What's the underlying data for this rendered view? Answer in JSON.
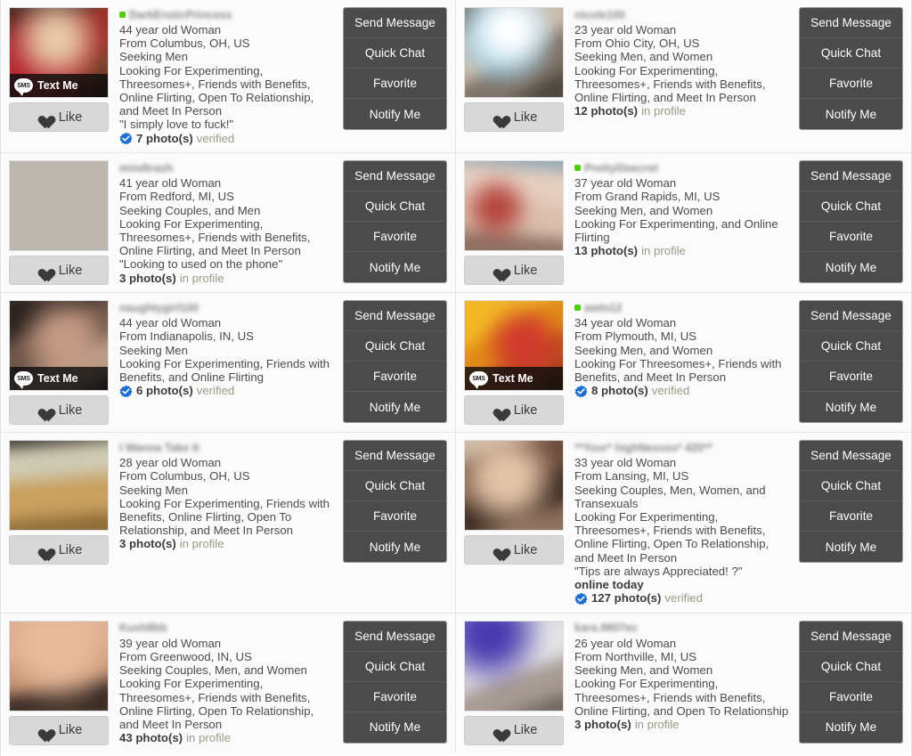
{
  "ui": {
    "like_label": "Like",
    "text_me_label": "Text Me",
    "sms_badge_label": "SMS",
    "actions": [
      "Send Message",
      "Quick Chat",
      "Favorite",
      "Notify Me"
    ]
  },
  "cards": [
    {
      "username": "DarkEroticPrincess",
      "online_dot": true,
      "text_me": true,
      "photo_class": "ph-1",
      "lines": [
        "44 year old Woman",
        "From Columbus, OH, US",
        "Seeking Men",
        "Looking For Experimenting, Threesomes+, Friends with Benefits, Online Flirting, Open To Relationship, and Meet In Person"
      ],
      "quote": "\"I simply love to fuck!\"",
      "online_today": null,
      "photo_count": "7 photo(s)",
      "photo_status": "verified",
      "verified": true
    },
    {
      "username": "nicole100",
      "online_dot": false,
      "text_me": false,
      "photo_class": "ph-2",
      "lines": [
        "23 year old Woman",
        "From Ohio City, OH, US",
        "Seeking Men, and Women",
        "Looking For Experimenting, Threesomes+, Friends with Benefits, Online Flirting, and Meet In Person"
      ],
      "quote": null,
      "online_today": null,
      "photo_count": "12 photo(s)",
      "photo_status": "in profile",
      "verified": false
    },
    {
      "username": "mindtrash",
      "online_dot": false,
      "text_me": false,
      "photo_class": "ph-3",
      "lines": [
        "41 year old Woman",
        "From Redford, MI, US",
        "Seeking Couples, and Men",
        "Looking For Experimenting, Threesomes+, Friends with Benefits, Online Flirting, and Meet In Person"
      ],
      "quote": "\"Looking to used on the phone\"",
      "online_today": null,
      "photo_count": "3 photo(s)",
      "photo_status": "in profile",
      "verified": false
    },
    {
      "username": "Prettylilsecret",
      "online_dot": true,
      "text_me": false,
      "photo_class": "ph-4",
      "lines": [
        "37 year old Woman",
        "From Grand Rapids, MI, US",
        "Seeking Men, and Women",
        "Looking For Experimenting, and Online Flirting"
      ],
      "quote": null,
      "online_today": null,
      "photo_count": "13 photo(s)",
      "photo_status": "in profile",
      "verified": false
    },
    {
      "username": "naughtygirl100",
      "online_dot": false,
      "text_me": true,
      "photo_class": "ph-5",
      "lines": [
        "44 year old Woman",
        "From Indianapolis, IN, US",
        "Seeking Men",
        "Looking For Experimenting, Friends with Benefits, and Online Flirting"
      ],
      "quote": null,
      "online_today": null,
      "photo_count": "6 photo(s)",
      "photo_status": "verified",
      "verified": true
    },
    {
      "username": "awtn12",
      "online_dot": true,
      "text_me": true,
      "photo_class": "ph-6",
      "lines": [
        "34 year old Woman",
        "From Plymouth, MI, US",
        "Seeking Men, and Women",
        "Looking For Threesomes+, Friends with Benefits, and Meet In Person"
      ],
      "quote": null,
      "online_today": null,
      "photo_count": "8 photo(s)",
      "photo_status": "verified",
      "verified": true
    },
    {
      "username": "I Wanna Take It",
      "online_dot": false,
      "text_me": false,
      "photo_class": "ph-7",
      "lines": [
        "28 year old Woman",
        "From Columbus, OH, US",
        "Seeking Men",
        "Looking For Experimenting, Friends with Benefits, Online Flirting, Open To Relationship, and Meet In Person"
      ],
      "quote": null,
      "online_today": null,
      "photo_count": "3 photo(s)",
      "photo_status": "in profile",
      "verified": false
    },
    {
      "username": "**Your* highNessss* 420**",
      "online_dot": false,
      "text_me": false,
      "photo_class": "ph-8",
      "lines": [
        "33 year old Woman",
        "From Lansing, MI, US",
        "Seeking Couples, Men, Women, and Transexuals",
        "Looking For Experimenting, Threesomes+, Friends with Benefits, Online Flirting, Open To Relationship, and Meet In Person"
      ],
      "quote": "\"Tips are always Appreciated! ?\"",
      "online_today": "online today",
      "photo_count": "127 photo(s)",
      "photo_status": "verified",
      "verified": true
    },
    {
      "username": "Kush8bb",
      "online_dot": false,
      "text_me": false,
      "photo_class": "ph-9",
      "lines": [
        "39 year old Woman",
        "From Greenwood, IN, US",
        "Seeking Couples, Men, and Women",
        "Looking For Experimenting, Threesomes+, Friends with Benefits, Online Flirting, Open To Relationship, and Meet In Person"
      ],
      "quote": null,
      "online_today": null,
      "photo_count": "43 photo(s)",
      "photo_status": "in profile",
      "verified": false
    },
    {
      "username": "kara.9807ec",
      "online_dot": false,
      "text_me": false,
      "photo_class": "ph-10",
      "lines": [
        "26 year old Woman",
        "From Northville, MI, US",
        "Seeking Men, and Women",
        "Looking For Experimenting, Threesomes+, Friends with Benefits, Online Flirting, and Open To Relationship"
      ],
      "quote": null,
      "online_today": null,
      "photo_count": "3 photo(s)",
      "photo_status": "in profile",
      "verified": false
    }
  ],
  "colors": {
    "action_bg": "#4b4b4b",
    "like_bg": "#d8d8d8",
    "online_dot": "#4ecf07",
    "verified_blue": "#1c6fd0",
    "text": "#4c4c4c"
  }
}
